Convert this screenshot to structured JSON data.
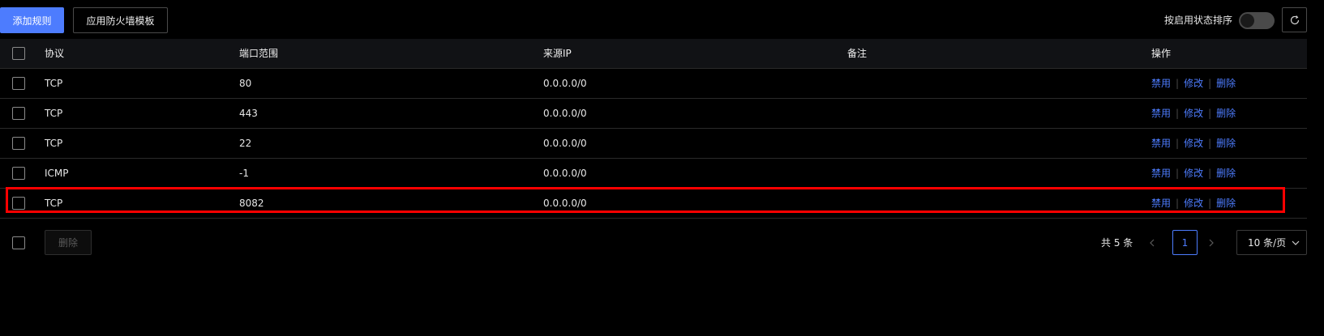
{
  "toolbar": {
    "add_rule_label": "添加规则",
    "apply_template_label": "应用防火墙模板",
    "sort_label": "按启用状态排序",
    "sort_toggle_on": false
  },
  "colors": {
    "accent": "#4d7cfe",
    "highlight": "#ff0000",
    "background": "#000000"
  },
  "table": {
    "headers": {
      "protocol": "协议",
      "port_range": "端口范围",
      "source_ip": "来源IP",
      "remark": "备注",
      "actions": "操作"
    },
    "rows": [
      {
        "protocol": "TCP",
        "port": "80",
        "source_ip": "0.0.0.0/0",
        "remark": "",
        "disable": "禁用",
        "edit": "修改",
        "delete": "删除"
      },
      {
        "protocol": "TCP",
        "port": "443",
        "source_ip": "0.0.0.0/0",
        "remark": "",
        "disable": "禁用",
        "edit": "修改",
        "delete": "删除"
      },
      {
        "protocol": "TCP",
        "port": "22",
        "source_ip": "0.0.0.0/0",
        "remark": "",
        "disable": "禁用",
        "edit": "修改",
        "delete": "删除"
      },
      {
        "protocol": "ICMP",
        "port": "-1",
        "source_ip": "0.0.0.0/0",
        "remark": "",
        "disable": "禁用",
        "edit": "修改",
        "delete": "删除"
      },
      {
        "protocol": "TCP",
        "port": "8082",
        "source_ip": "0.0.0.0/0",
        "remark": "",
        "disable": "禁用",
        "edit": "修改",
        "delete": "删除"
      }
    ]
  },
  "footer": {
    "bulk_delete_label": "删除",
    "total_text": "共 5 条",
    "current_page": "1",
    "page_size": "10 条/页"
  },
  "icons": {
    "refresh": "refresh-icon",
    "prev": "chevron-left-icon",
    "next": "chevron-right-icon",
    "dropdown": "chevron-down-icon"
  }
}
